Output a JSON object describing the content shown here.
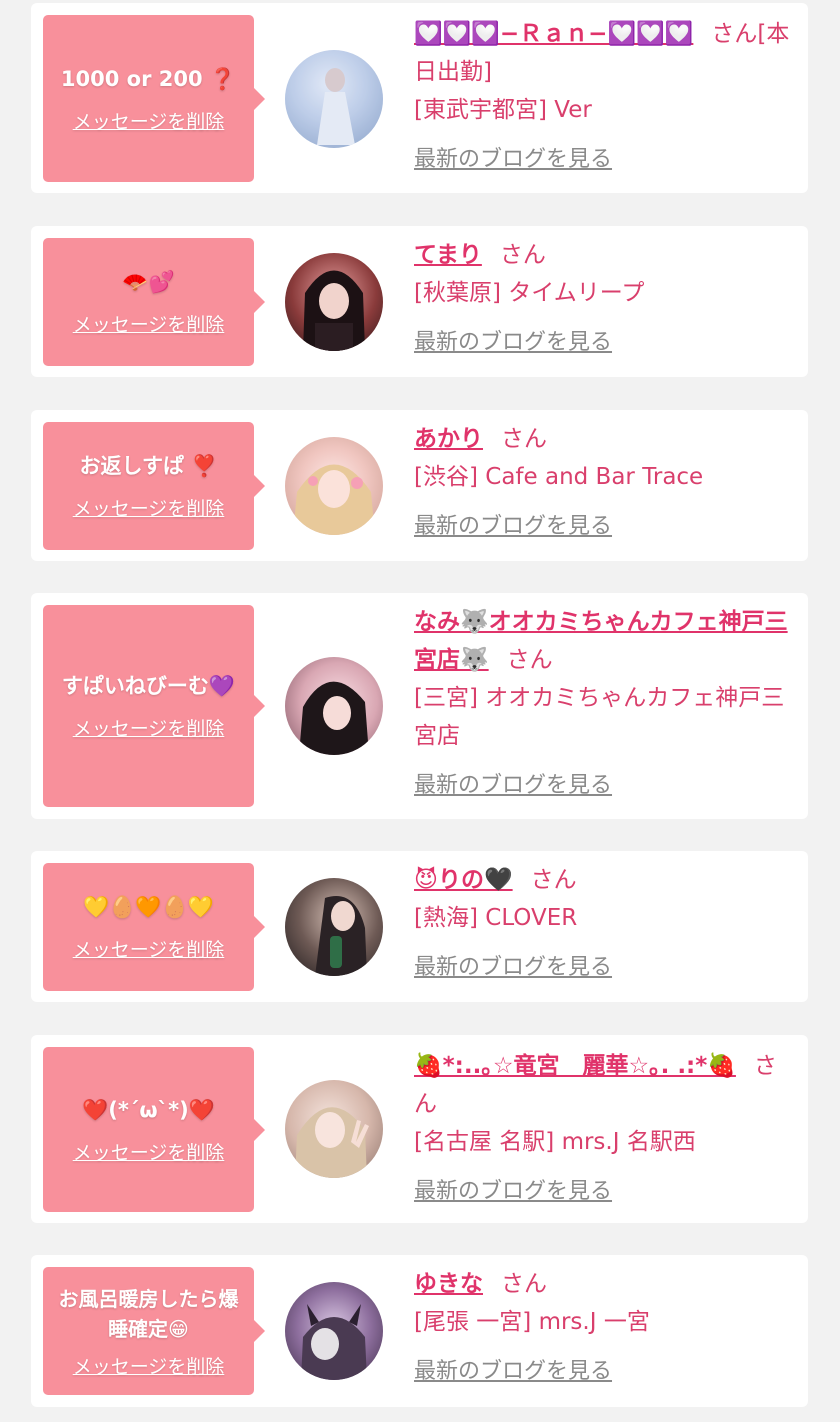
{
  "delete_label": "メッセージを削除",
  "san_label": "さん",
  "blog_label": "最新のブログを見る",
  "colors": {
    "bubble": "#f8909b",
    "name": "#e0336a",
    "text": "#d93f6c",
    "blog": "#8a8a8a"
  },
  "items": [
    {
      "message": "1000 or 200 ❓",
      "name": "💟💟💟−Ｒａｎ−💟💟💟",
      "shop": "[東武宇都宮] Ver",
      "avatar": "avatar-photo-white-dress"
    },
    {
      "message": "🪭💕",
      "name": "てまり",
      "shop": "[秋葉原] タイムリープ",
      "avatar": "avatar-photo-gothic-girl"
    },
    {
      "message": "お返しすぱ ❣️",
      "name": "あかり",
      "shop": "[渋谷] Cafe and Bar Trace",
      "avatar": "avatar-photo-blonde-girl"
    },
    {
      "message": "すぱいねびーむ💜",
      "name": "なみ🐺オオカミちゃんカフェ神戸三宮店🐺",
      "shop": "[三宮] オオカミちゃんカフェ神戸三宮店",
      "avatar": "avatar-photo-black-hair"
    },
    {
      "message": "💛🥚🧡🥚💛",
      "name": "😈りの🖤",
      "shop": "[熱海] CLOVER",
      "avatar": "avatar-photo-drink"
    },
    {
      "message": "❤️(*´ω`*)❤️",
      "name": "🍓*:..｡☆竜宮　麗華☆｡. .:*🍓",
      "shop": "[名古屋 名駅] mrs.J 名駅西",
      "avatar": "avatar-photo-peace-sign"
    },
    {
      "message": "お風呂暖房したら爆睡確定😁",
      "name": "ゆきな",
      "shop": "[尾張 一宮] mrs.J 一宮",
      "avatar": "avatar-photo-cat-ears"
    }
  ]
}
